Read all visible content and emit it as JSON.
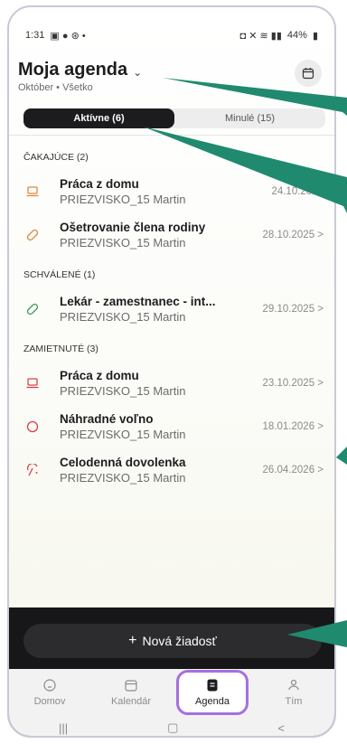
{
  "status": {
    "time": "1:31",
    "battery": "44%"
  },
  "header": {
    "title": "Moja agenda",
    "subtitle": "Október • Všetko"
  },
  "tabs": {
    "active": "Aktívne (6)",
    "inactive": "Minulé (15)"
  },
  "sections": [
    {
      "label": "ČAKAJÚCE (2)",
      "items": [
        {
          "title": "Práca z domu",
          "person": "PRIEZVISKO_15 Martin",
          "date": "24.10.2025",
          "icon": "laptop-icon",
          "color": "#e0893b"
        },
        {
          "title": "Ošetrovanie člena rodiny",
          "person": "PRIEZVISKO_15 Martin",
          "date": "28.10.2025 >",
          "icon": "bandage-icon",
          "color": "#e0893b"
        }
      ]
    },
    {
      "label": "SCHVÁLENÉ (1)",
      "items": [
        {
          "title": "Lekár - zamestnanec - int...",
          "person": "PRIEZVISKO_15 Martin",
          "date": "29.10.2025 >",
          "icon": "bandage-icon",
          "color": "#3a9a5b"
        }
      ]
    },
    {
      "label": "ZAMIETNUTÉ (3)",
      "items": [
        {
          "title": "Práca z domu",
          "person": "PRIEZVISKO_15 Martin",
          "date": "23.10.2025 >",
          "icon": "laptop-icon",
          "color": "#d9414d"
        },
        {
          "title": "Náhradné voľno",
          "person": "PRIEZVISKO_15 Martin",
          "date": "18.01.2026 >",
          "icon": "circle-icon",
          "color": "#d9414d"
        },
        {
          "title": "Celodenná dovolenka",
          "person": "PRIEZVISKO_15 Martin",
          "date": "26.04.2026 >",
          "icon": "beach-umbrella-icon",
          "color": "#d9414d"
        }
      ]
    }
  ],
  "new_request": "Nová žiadosť",
  "bottom_nav": [
    {
      "label": "Domov",
      "icon": "home-icon"
    },
    {
      "label": "Kalendár",
      "icon": "calendar-icon"
    },
    {
      "label": "Agenda",
      "icon": "agenda-icon"
    },
    {
      "label": "Tím",
      "icon": "team-icon"
    }
  ],
  "colors": {
    "accent_highlight": "#a66fe0",
    "arrow": "#1f8a6e"
  }
}
